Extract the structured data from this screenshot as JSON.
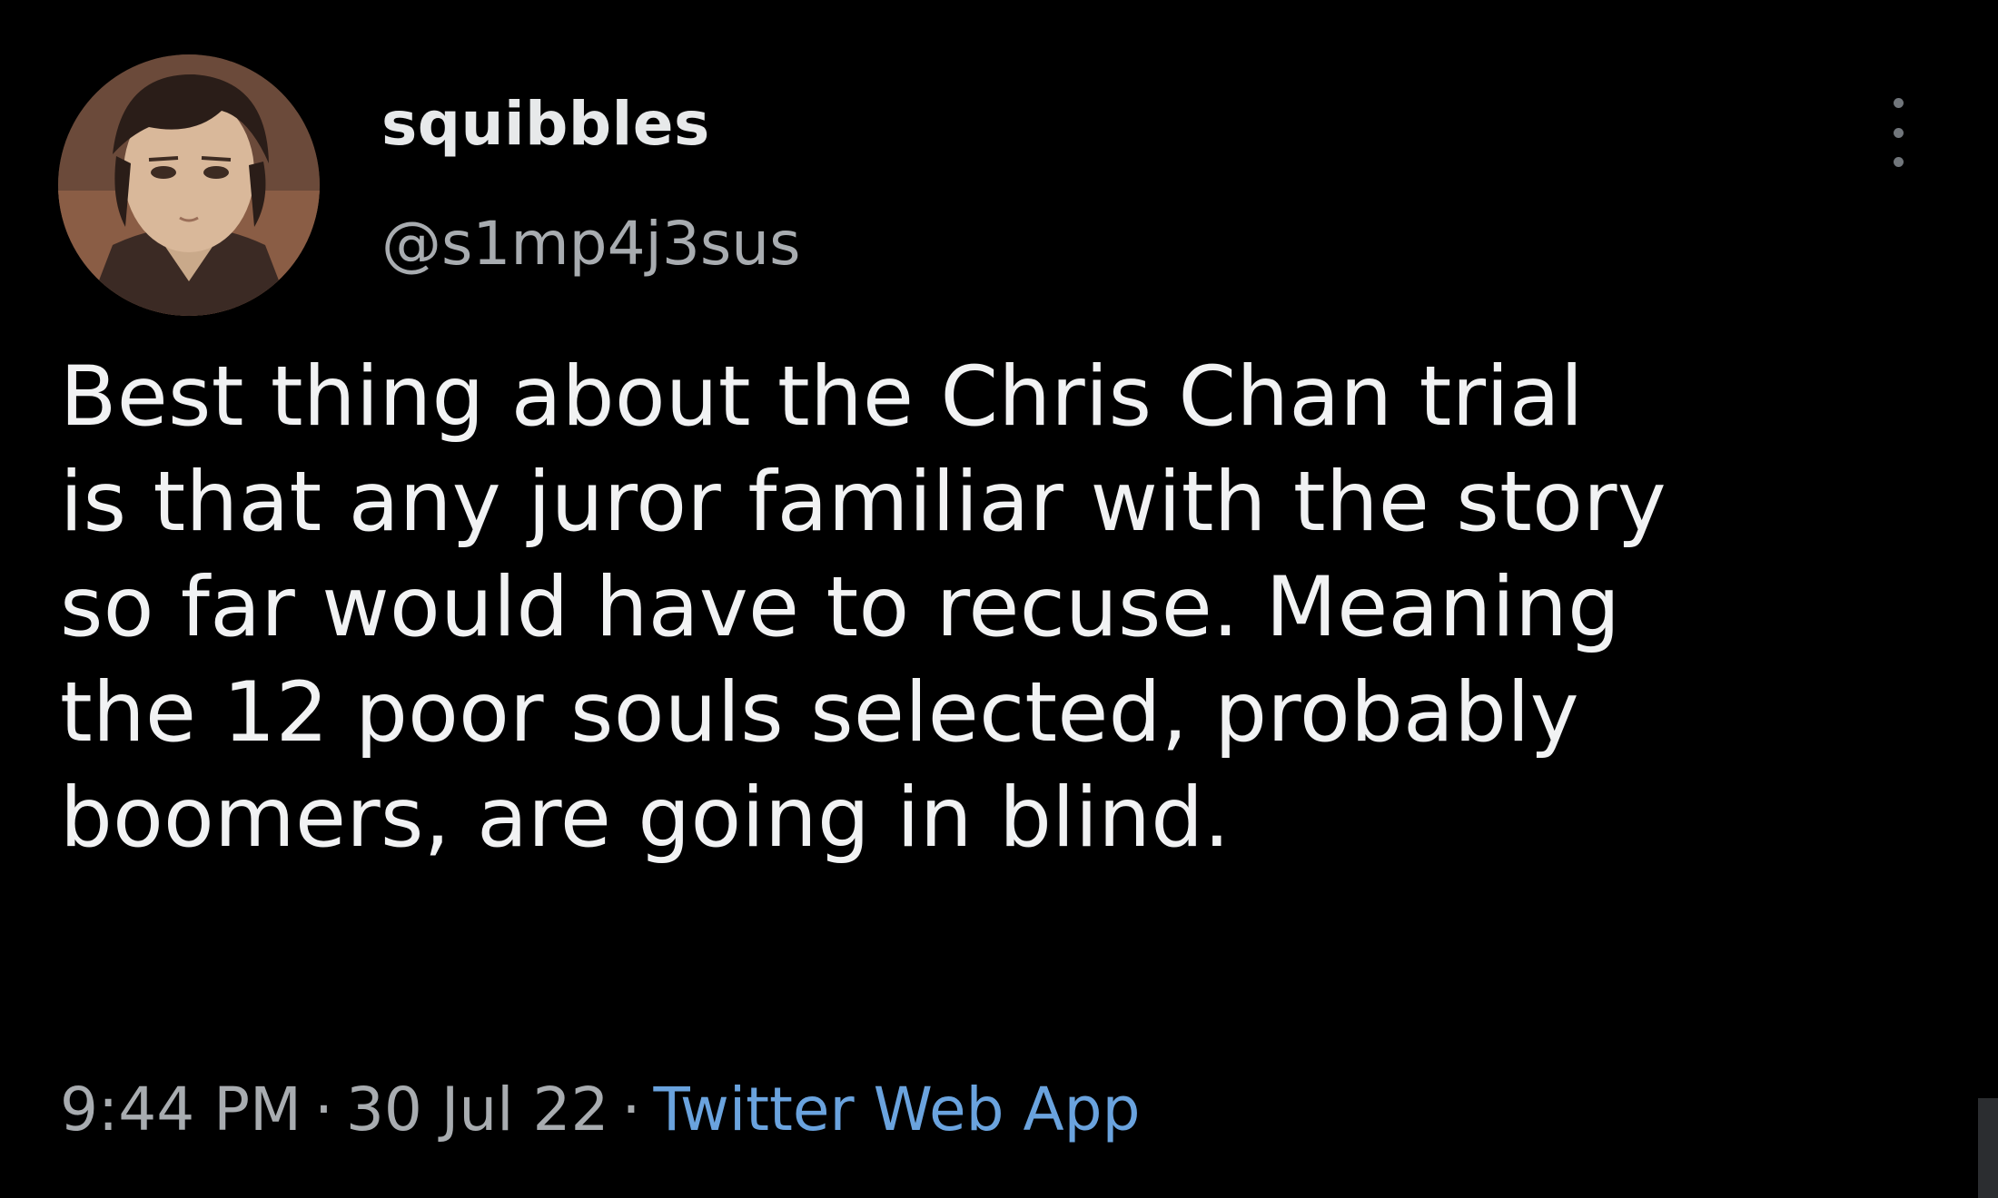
{
  "author": {
    "display_name": "squibbles",
    "handle": "@s1mp4j3sus"
  },
  "tweet": {
    "lines": [
      "Best thing about the Chris Chan trial",
      "is that any juror familiar with the story",
      "so far would have to recuse. Meaning",
      "the 12 poor souls selected, probably",
      "boomers, are going in blind."
    ]
  },
  "meta": {
    "time": "9:44 PM",
    "separator": "·",
    "date": "30 Jul 22",
    "source": "Twitter Web App"
  },
  "icons": {
    "more": "more-vertical-icon",
    "avatar": "user-avatar-image"
  },
  "colors": {
    "background": "#000000",
    "text": "#f1f2f3",
    "secondary": "#a8acb0",
    "link": "#6aa3de"
  }
}
